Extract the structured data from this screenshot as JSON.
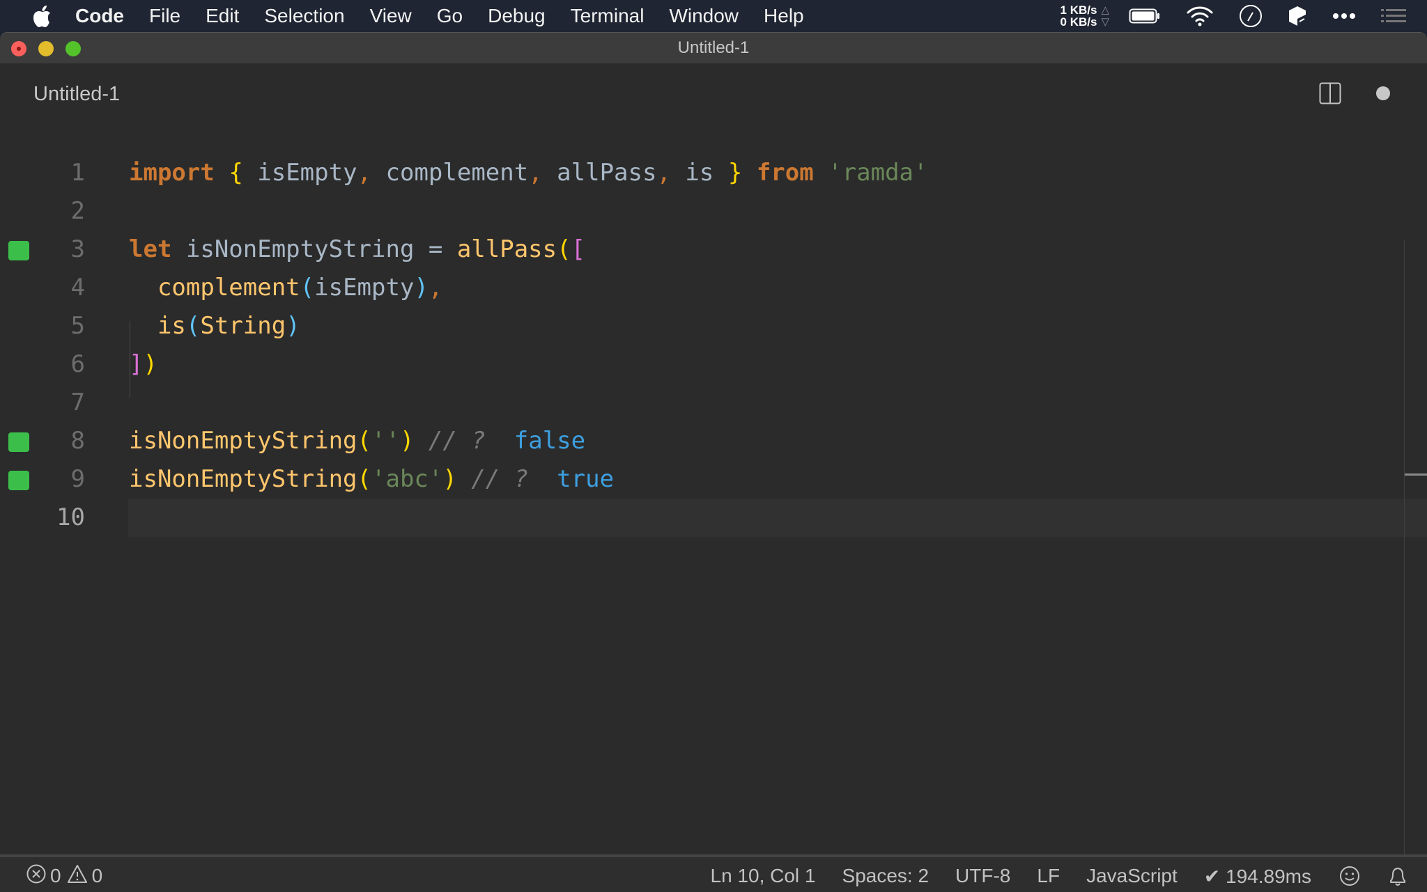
{
  "menubar": {
    "app_name": "Code",
    "items": [
      "File",
      "Edit",
      "Selection",
      "View",
      "Go",
      "Debug",
      "Terminal",
      "Window",
      "Help"
    ],
    "net_up": "1 KB/s",
    "net_down": "0 KB/s",
    "tray_icons": [
      "battery-icon",
      "wifi-icon",
      "clock-icon",
      "dropbox-icon",
      "more-icon",
      "notification-center-icon"
    ]
  },
  "window": {
    "title": "Untitled-1"
  },
  "tab": {
    "label": "Untitled-1",
    "dirty": true
  },
  "editor": {
    "lines": [
      {
        "n": "1",
        "marker": false
      },
      {
        "n": "2",
        "marker": false
      },
      {
        "n": "3",
        "marker": true
      },
      {
        "n": "4",
        "marker": false
      },
      {
        "n": "5",
        "marker": false
      },
      {
        "n": "6",
        "marker": false
      },
      {
        "n": "7",
        "marker": false
      },
      {
        "n": "8",
        "marker": true
      },
      {
        "n": "9",
        "marker": true
      },
      {
        "n": "10",
        "marker": false
      }
    ],
    "tokens": {
      "l1": [
        "import",
        " ",
        "{",
        " isEmpty",
        ",",
        " complement",
        ",",
        " allPass",
        ",",
        " is ",
        "}",
        " ",
        "from",
        " ",
        "'ramda'"
      ],
      "l3": [
        "let",
        " isNonEmptyString = ",
        "allPass",
        "(",
        "["
      ],
      "l4": [
        "  ",
        "complement",
        "(",
        "isEmpty",
        ")",
        ","
      ],
      "l5": [
        "  ",
        "is",
        "(",
        "String",
        ")"
      ],
      "l6": [
        "]",
        ")"
      ],
      "l8": [
        "isNonEmptyString",
        "(",
        "''",
        ")",
        " // ?",
        "  ",
        "false"
      ],
      "l9": [
        "isNonEmptyString",
        "(",
        "'abc'",
        ")",
        " // ?",
        "  ",
        "true"
      ]
    },
    "current_line": "10"
  },
  "statusbar": {
    "errors": "0",
    "warnings": "0",
    "cursor": "Ln 10, Col 1",
    "indent": "Spaces: 2",
    "encoding": "UTF-8",
    "eol": "LF",
    "language": "JavaScript",
    "timing": "✔ 194.89ms"
  },
  "colors": {
    "keyword": "#cc7832",
    "function": "#ffc66d",
    "string": "#6a8759",
    "identifier": "#a9b7c6",
    "bracket_level1": "#ffd700",
    "bracket_level2": "#da70d6",
    "bracket_level3": "#5fc3f5",
    "inline_value": "#3d9fe0",
    "gutter_marker": "#3bbf4a"
  }
}
